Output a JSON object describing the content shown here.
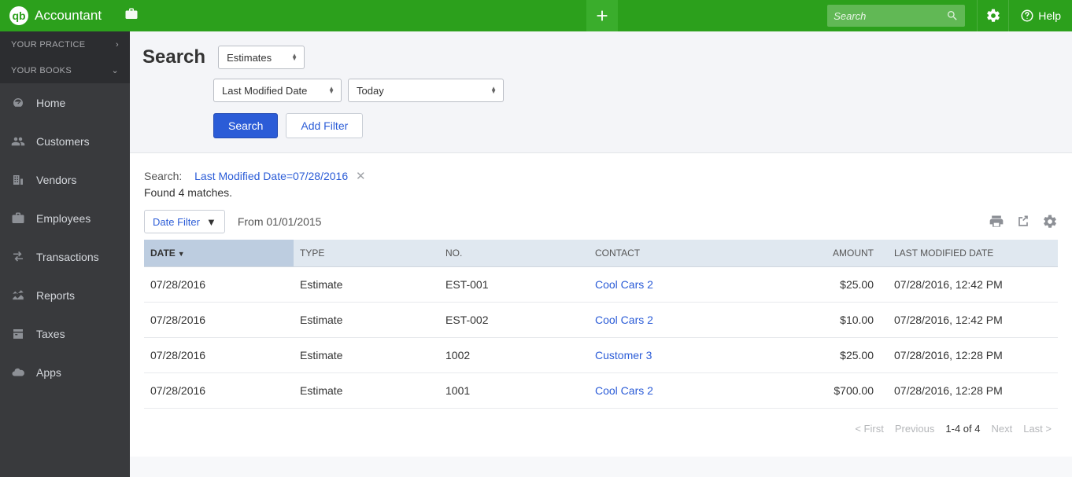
{
  "header": {
    "logo_text": "Accountant",
    "search_placeholder": "Search",
    "help_label": "Help"
  },
  "sidebar": {
    "section_practice": "YOUR PRACTICE",
    "section_books": "YOUR BOOKS",
    "items": [
      {
        "label": "Home"
      },
      {
        "label": "Customers"
      },
      {
        "label": "Vendors"
      },
      {
        "label": "Employees"
      },
      {
        "label": "Transactions"
      },
      {
        "label": "Reports"
      },
      {
        "label": "Taxes"
      },
      {
        "label": "Apps"
      }
    ]
  },
  "search_panel": {
    "title": "Search",
    "type_select": "Estimates",
    "field_select": "Last Modified Date",
    "range_select": "Today",
    "search_btn": "Search",
    "add_filter_btn": "Add Filter"
  },
  "results": {
    "search_label": "Search:",
    "filter_chip": "Last Modified Date=07/28/2016",
    "count_text": "Found 4 matches.",
    "date_filter_btn": "Date Filter",
    "from_text": "From 01/01/2015"
  },
  "table": {
    "cols": {
      "date": "DATE",
      "type": "TYPE",
      "no": "NO.",
      "contact": "CONTACT",
      "amount": "AMOUNT",
      "lmd": "LAST MODIFIED DATE"
    },
    "rows": [
      {
        "date": "07/28/2016",
        "type": "Estimate",
        "no": "EST-001",
        "contact": "Cool Cars 2",
        "amount": "$25.00",
        "lmd": "07/28/2016, 12:42 PM"
      },
      {
        "date": "07/28/2016",
        "type": "Estimate",
        "no": "EST-002",
        "contact": "Cool Cars 2",
        "amount": "$10.00",
        "lmd": "07/28/2016, 12:42 PM"
      },
      {
        "date": "07/28/2016",
        "type": "Estimate",
        "no": "1002",
        "contact": "Customer 3",
        "amount": "$25.00",
        "lmd": "07/28/2016, 12:28 PM"
      },
      {
        "date": "07/28/2016",
        "type": "Estimate",
        "no": "1001",
        "contact": "Cool Cars 2",
        "amount": "$700.00",
        "lmd": "07/28/2016, 12:28 PM"
      }
    ]
  },
  "pager": {
    "first": "< First",
    "prev": "Previous",
    "range": "1-4 of 4",
    "next": "Next",
    "last": "Last >"
  }
}
